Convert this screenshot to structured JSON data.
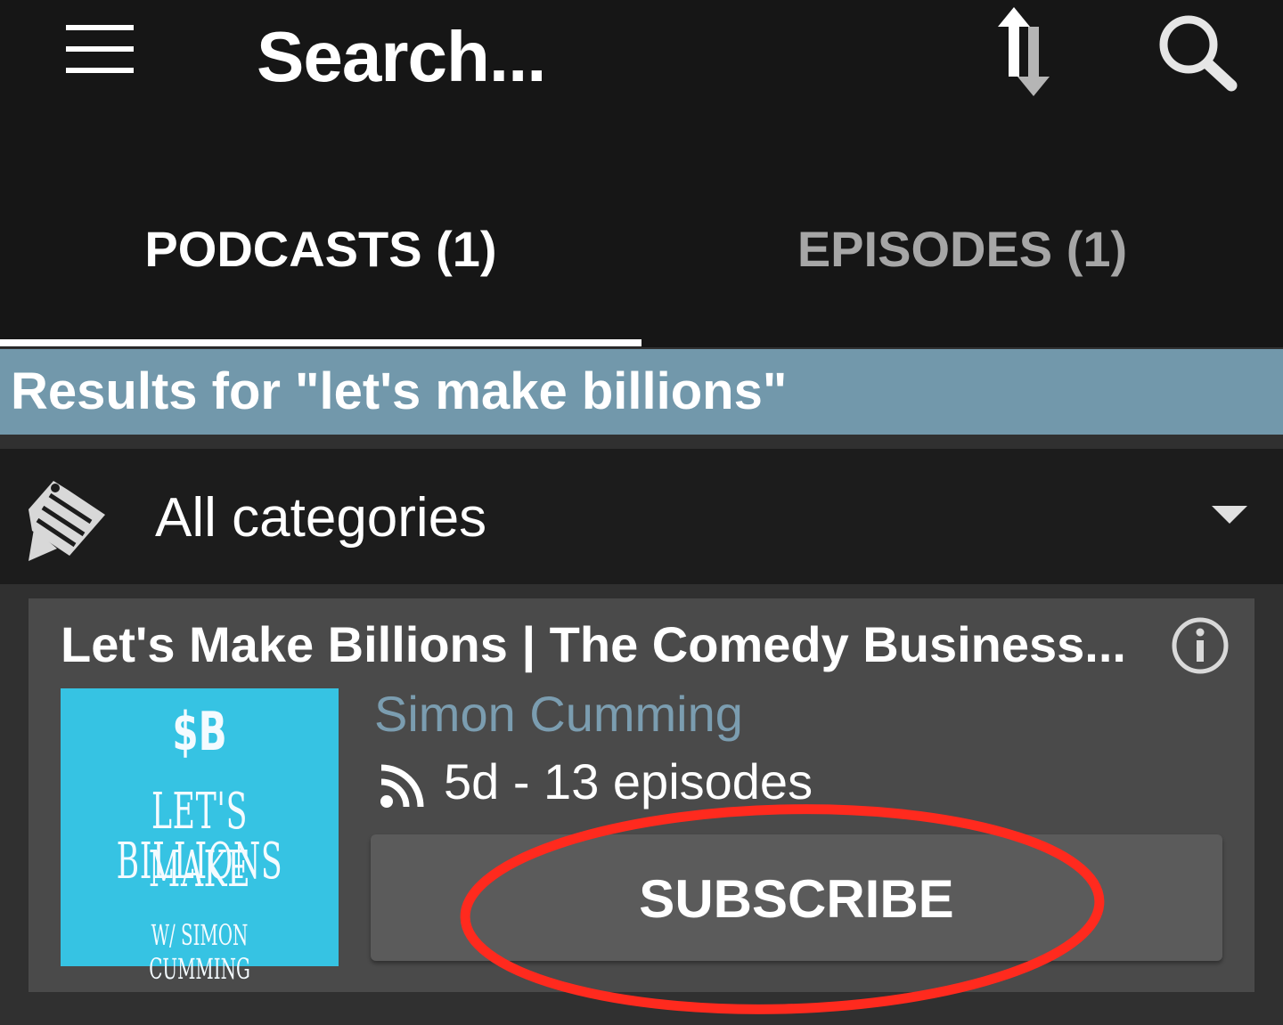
{
  "toolbar": {
    "menu_icon": "hamburger-icon",
    "search_placeholder": "Search...",
    "sort_icon": "sort-arrows-icon",
    "search_icon": "magnifier-icon"
  },
  "tabs": [
    {
      "label": "PODCASTS (1)",
      "selected": true
    },
    {
      "label": "EPISODES (1)",
      "selected": false
    }
  ],
  "results": {
    "text": "Results for \"let's make billions\""
  },
  "category_filter": {
    "icon": "tag-pencil-icon",
    "selected": "All categories"
  },
  "podcast": {
    "title": "Let's Make Billions | The Comedy Business...",
    "author": "Simon Cumming",
    "meta": "5d - 13 episodes",
    "feed_icon": "rss-icon",
    "info_icon": "info-icon",
    "subscribe_label": "SUBSCRIBE",
    "artwork": {
      "line1": "$B",
      "line2": "LET'S MAKE",
      "line3": "BILLIONS",
      "line4": "W/ SIMON CUMMING"
    }
  },
  "colors": {
    "appbar_bg": "#161616",
    "results_bar": "#7298ab",
    "author": "#7b9db0",
    "artwork_bg": "#36c3e3",
    "annotation": "#ff2a1e"
  }
}
